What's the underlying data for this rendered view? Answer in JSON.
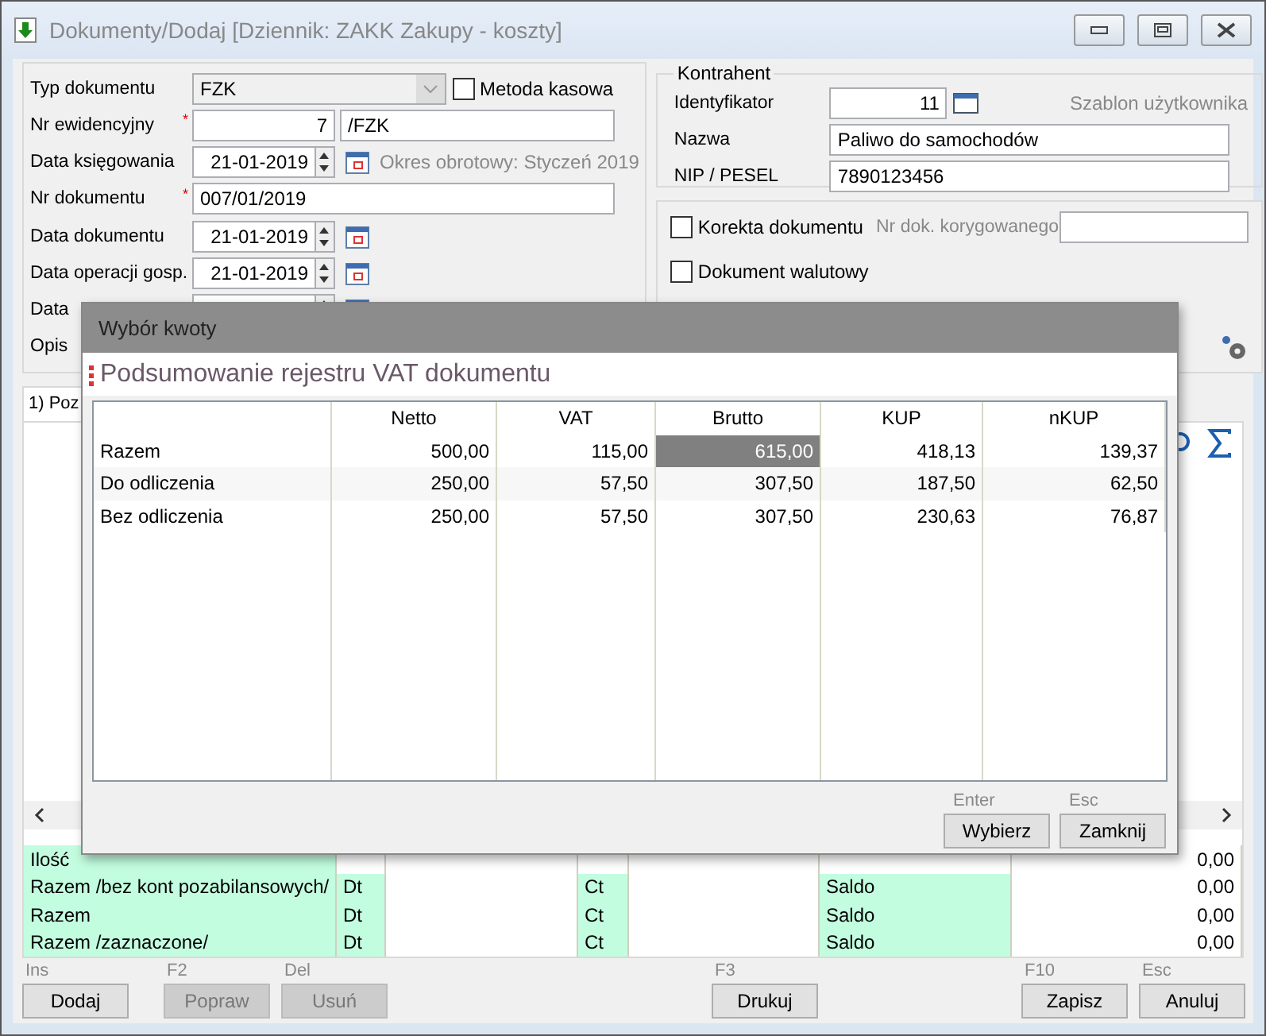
{
  "window": {
    "title": "Dokumenty/Dodaj [Dziennik: ZAKK  Zakupy - koszty]"
  },
  "document": {
    "rows": [
      {
        "kind": "select",
        "label": "Typ dokumentu",
        "value": "FZK",
        "checkbox": {
          "label": "Metoda kasowa",
          "checked": false
        }
      },
      {
        "kind": "number",
        "label": "Nr ewidencyjny",
        "mark": "*",
        "value": "7",
        "suffix": "/FZK"
      },
      {
        "kind": "date",
        "label": "Data księgowania",
        "value": "21-01-2019",
        "note": "Okres obrotowy: Styczeń 2019"
      },
      {
        "kind": "text",
        "label": "Nr dokumentu",
        "mark": "*",
        "value": "007/01/2019"
      },
      {
        "kind": "date",
        "label": "Data dokumentu",
        "value": "21-01-2019"
      },
      {
        "kind": "date",
        "label": "Data operacji gosp.",
        "value": "21-01-2019"
      },
      {
        "kind": "date",
        "label": "Data"
      },
      {
        "kind": "text",
        "label": "Opis"
      }
    ]
  },
  "contractor": {
    "title": "Kontrahent",
    "template": "Szablon użytkownika",
    "fields": [
      {
        "kind": "id",
        "label": "Identyfikator",
        "value": "11"
      },
      {
        "kind": "text",
        "label": "Nazwa",
        "value": "Paliwo do samochodów"
      },
      {
        "kind": "text",
        "label": "NIP / PESEL",
        "value": "7890123456"
      }
    ]
  },
  "options": {
    "correction": {
      "label": "Korekta dokumentu",
      "checked": false,
      "field_label": "Nr dok. korygowanego"
    },
    "currency": {
      "label": "Dokument walutowy",
      "checked": false
    }
  },
  "tabs": [
    {
      "label": "1) Poz",
      "selected": true
    }
  ],
  "summary": [
    {
      "label": "Ilość",
      "value": "0,00"
    },
    {
      "label": "Razem /bez kont pozabilansowych/",
      "dt": "Dt",
      "ct": "Ct",
      "saldo": "Saldo",
      "value": "0,00"
    },
    {
      "label": "Razem",
      "dt": "Dt",
      "ct": "Ct",
      "saldo": "Saldo",
      "value": "0,00"
    },
    {
      "label": "Razem /zaznaczone/",
      "dt": "Dt",
      "ct": "Ct",
      "saldo": "Saldo",
      "value": "0,00"
    }
  ],
  "buttons": [
    {
      "key": "Ins",
      "label": "Dodaj",
      "disabled": false
    },
    {
      "key": "F2",
      "label": "Popraw",
      "disabled": true
    },
    {
      "key": "Del",
      "label": "Usuń",
      "disabled": true
    },
    {
      "key": "F3",
      "label": "Drukuj",
      "disabled": false
    },
    {
      "key": "F10",
      "label": "Zapisz",
      "disabled": false
    },
    {
      "key": "Esc",
      "label": "Anuluj",
      "disabled": false
    }
  ],
  "dialog": {
    "title": "Wybór kwoty",
    "heading": "Podsumowanie rejestru VAT dokumentu",
    "columns": [
      "Netto",
      "VAT",
      "Brutto",
      "KUP",
      "nKUP"
    ],
    "rows": [
      {
        "label": "Razem",
        "cells": [
          {
            "value": "500,00",
            "selected": false
          },
          {
            "value": "115,00",
            "selected": false
          },
          {
            "value": "615,00",
            "selected": true
          },
          {
            "value": "418,13",
            "selected": false
          },
          {
            "value": "139,37",
            "selected": false
          }
        ]
      },
      {
        "label": "Do odliczenia",
        "cells": [
          {
            "value": "250,00",
            "selected": false
          },
          {
            "value": "57,50",
            "selected": false
          },
          {
            "value": "307,50",
            "selected": false
          },
          {
            "value": "187,50",
            "selected": false
          },
          {
            "value": "62,50",
            "selected": false
          }
        ]
      },
      {
        "label": "Bez odliczenia",
        "cells": [
          {
            "value": "250,00",
            "selected": false
          },
          {
            "value": "57,50",
            "selected": false
          },
          {
            "value": "307,50",
            "selected": false
          },
          {
            "value": "230,63",
            "selected": false
          },
          {
            "value": "76,87",
            "selected": false
          }
        ]
      }
    ],
    "buttons": [
      {
        "key": "Enter",
        "label": "Wybierz"
      },
      {
        "key": "Esc",
        "label": "Zamknij"
      }
    ]
  }
}
